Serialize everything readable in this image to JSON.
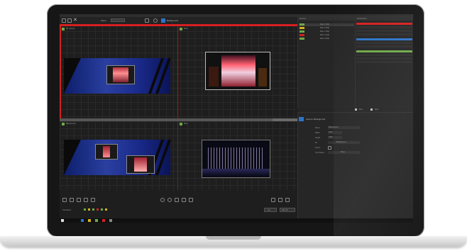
{
  "toolbar": {
    "zoom_label": "Zoom",
    "layer_label": "Background"
  },
  "canvas": {
    "top_left_label": "PC (active)",
    "top_right_label": "Main",
    "bottom_left_label": "Background",
    "bottom_right_label": "Main"
  },
  "layers": {
    "header_label": "Sources",
    "items": [
      "Main 1 (Fill)",
      "Main 2 (Fill)",
      "Main 3 (Fill)",
      "Main 4 (Fill)",
      "Main 5 (Fill)"
    ]
  },
  "outputs": {
    "header_label": "Destinations"
  },
  "transport": {
    "play_label": "Play",
    "stop_label": "Stop"
  },
  "inspector": {
    "title": "Source: Background",
    "fields": [
      {
        "label": "Name",
        "value": "Background"
      },
      {
        "label": "Width",
        "value": "1920"
      },
      {
        "label": "Height",
        "value": "1080"
      },
      {
        "label": "Fit",
        "value": "Background"
      },
      {
        "label": "Frame",
        "value": ""
      },
      {
        "label": "Test Pattern",
        "value": "None"
      }
    ]
  },
  "bottom": {
    "transitions_label": "Transitions",
    "take_label": "Take All",
    "cut_label": "Cut"
  },
  "colors": {
    "accent_red": "#d42020",
    "accent_blue": "#2d74c9",
    "accent_green": "#6fa84a",
    "accent_yellow": "#d4b020"
  }
}
